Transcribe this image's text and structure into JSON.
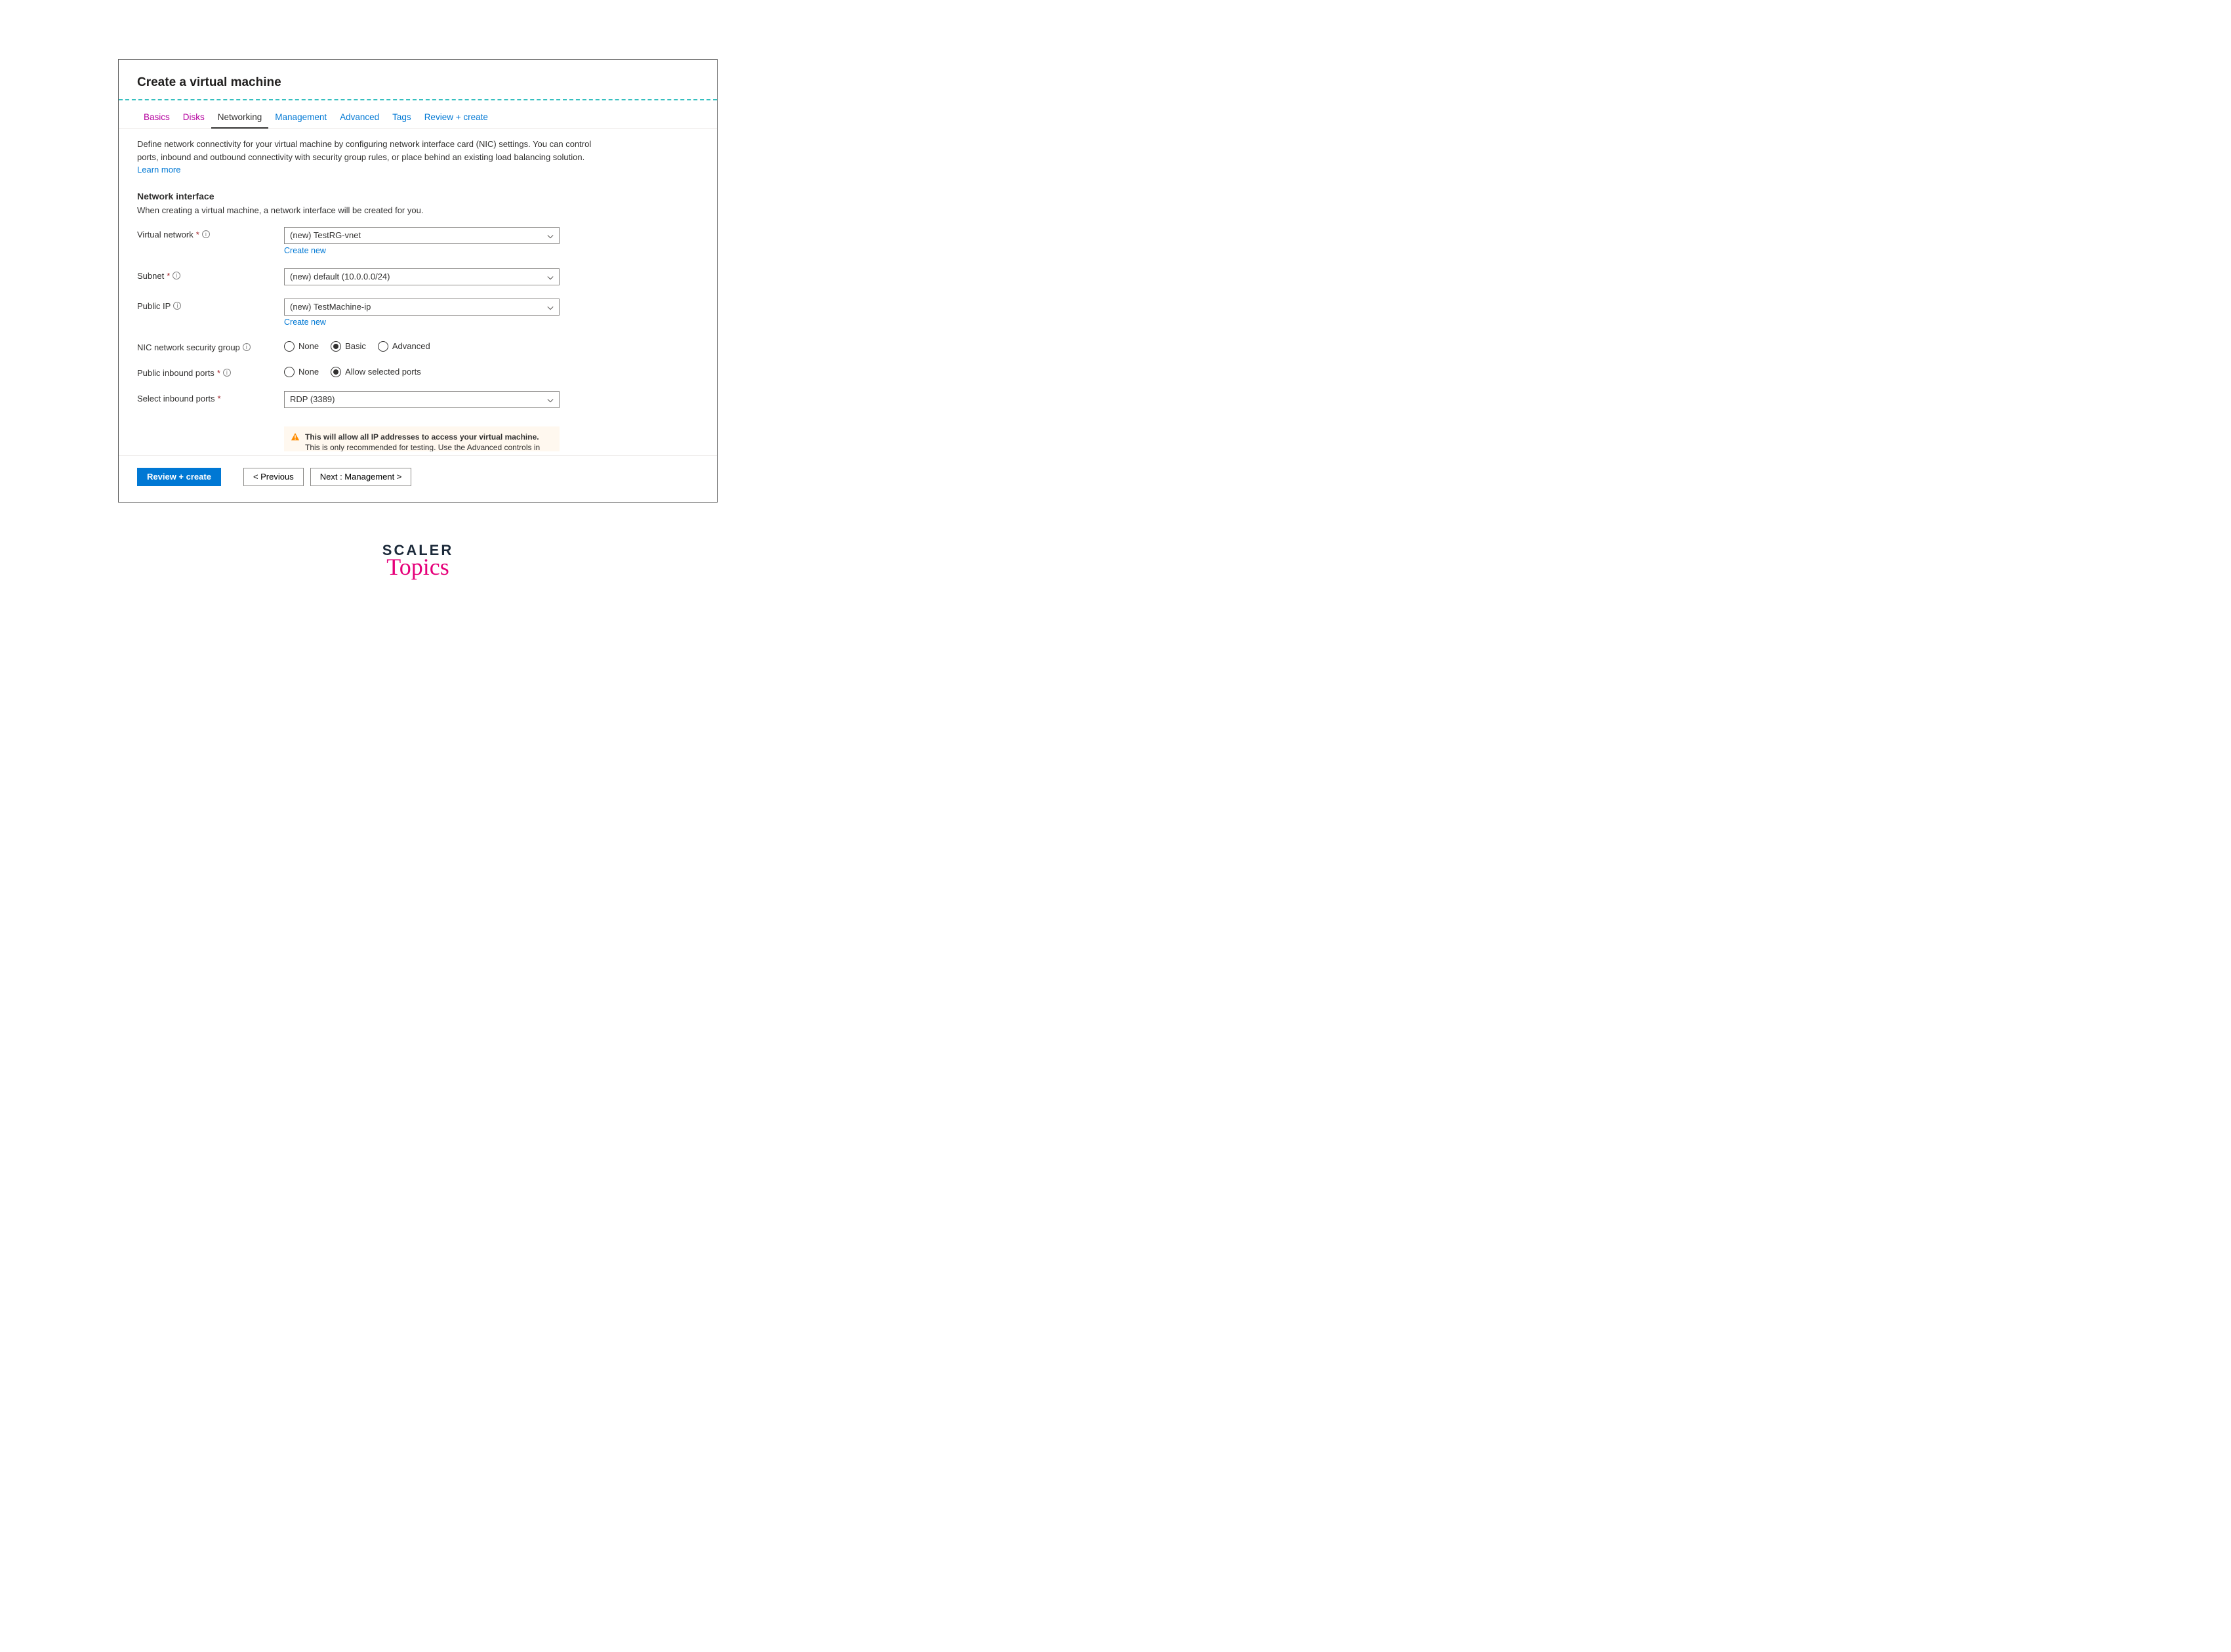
{
  "title": "Create a virtual machine",
  "tabs": {
    "basics": "Basics",
    "disks": "Disks",
    "networking": "Networking",
    "management": "Management",
    "advanced": "Advanced",
    "tags": "Tags",
    "review": "Review + create"
  },
  "intro": {
    "text": "Define network connectivity for your virtual machine by configuring network interface card (NIC) settings. You can control ports, inbound and outbound connectivity with security group rules, or place behind an existing load balancing solution.",
    "learn_more": "Learn more"
  },
  "section": {
    "heading": "Network interface",
    "sub": "When creating a virtual machine, a network interface will be created for you."
  },
  "fields": {
    "vnet": {
      "label": "Virtual network",
      "value": "(new) TestRG-vnet",
      "create": "Create new"
    },
    "subnet": {
      "label": "Subnet",
      "value": "(new) default (10.0.0.0/24)"
    },
    "publicip": {
      "label": "Public IP",
      "value": "(new) TestMachine-ip",
      "create": "Create new"
    },
    "nsg": {
      "label": "NIC network security group",
      "opts": {
        "none": "None",
        "basic": "Basic",
        "advanced": "Advanced"
      }
    },
    "inbound": {
      "label": "Public inbound ports",
      "opts": {
        "none": "None",
        "allow": "Allow selected ports"
      }
    },
    "select_ports": {
      "label": "Select inbound ports",
      "value": "RDP (3389)"
    }
  },
  "warning": {
    "bold": "This will allow all IP addresses to access your virtual machine.",
    "rest": " This is only recommended for testing.  Use the Advanced controls in the Networking tab"
  },
  "footer": {
    "review": "Review + create",
    "prev": "< Previous",
    "next": "Next : Management >"
  },
  "brand": {
    "top": "SCALER",
    "bottom": "Topics"
  },
  "glyphs": {
    "required": "*",
    "info": "i"
  }
}
